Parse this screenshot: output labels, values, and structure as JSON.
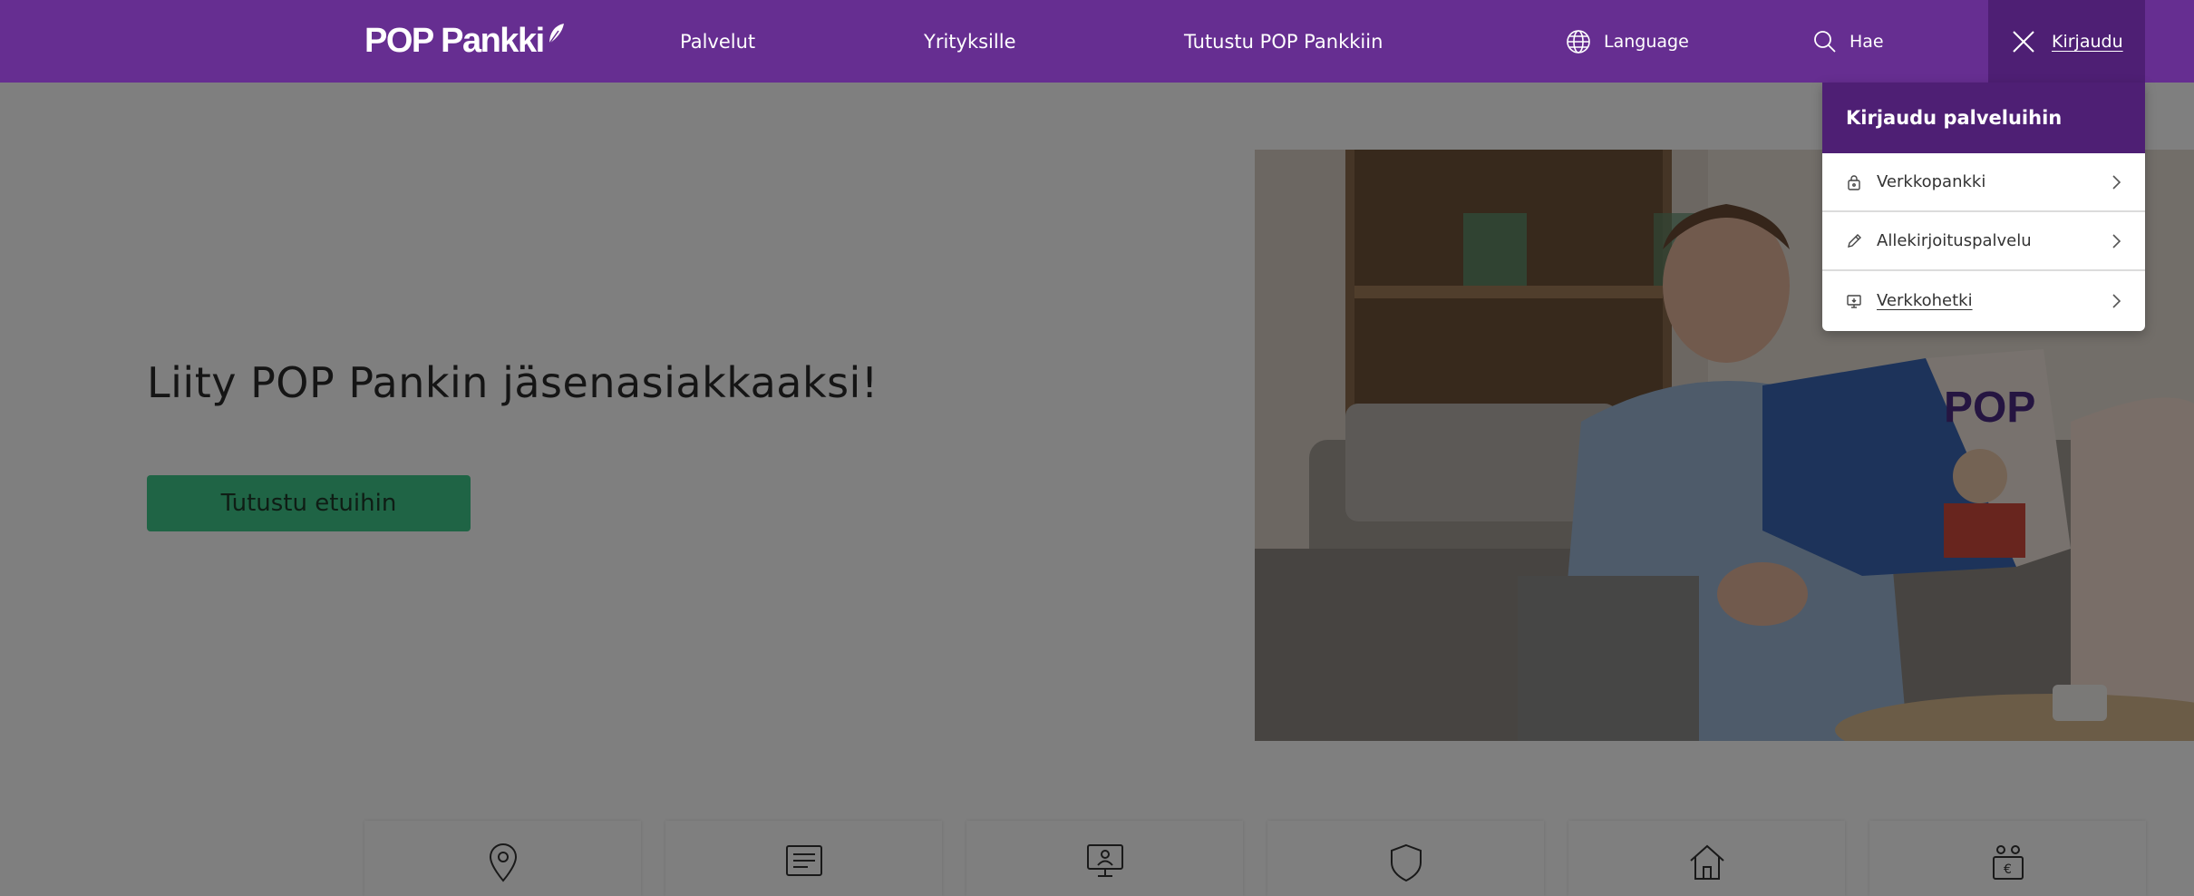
{
  "header": {
    "logo_text": "POP Pankki",
    "nav": {
      "services": "Palvelut",
      "business": "Yrityksille",
      "about": "Tutustu POP Pankkiin",
      "language": "Language",
      "search": "Hae",
      "login": "Kirjaudu"
    },
    "icons": {
      "language": "globe-icon",
      "search": "search-icon",
      "login": "close-icon"
    }
  },
  "hero": {
    "title": "Liity POP Pankin jäsenasiakkaaksi!",
    "button": "Tutustu etuihin"
  },
  "login_menu": {
    "title": "Kirjaudu palveluihin",
    "items": [
      {
        "label": "Verkkopankki",
        "icon": "lock-icon"
      },
      {
        "label": "Allekirjoituspalvelu",
        "icon": "pen-icon"
      },
      {
        "label": "Verkkohetki",
        "icon": "monitor-chat-icon"
      }
    ]
  },
  "tiles": [
    {
      "icon": "location-pin-icon"
    },
    {
      "icon": "document-icon"
    },
    {
      "icon": "presentation-person-icon"
    },
    {
      "icon": "shield-icon"
    },
    {
      "icon": "house-icon"
    },
    {
      "icon": "euro-gift-icon"
    }
  ],
  "colors": {
    "brand_purple": "#662e91",
    "brand_purple_dark": "#4e1f74",
    "cta_green": "#3ec88a"
  }
}
